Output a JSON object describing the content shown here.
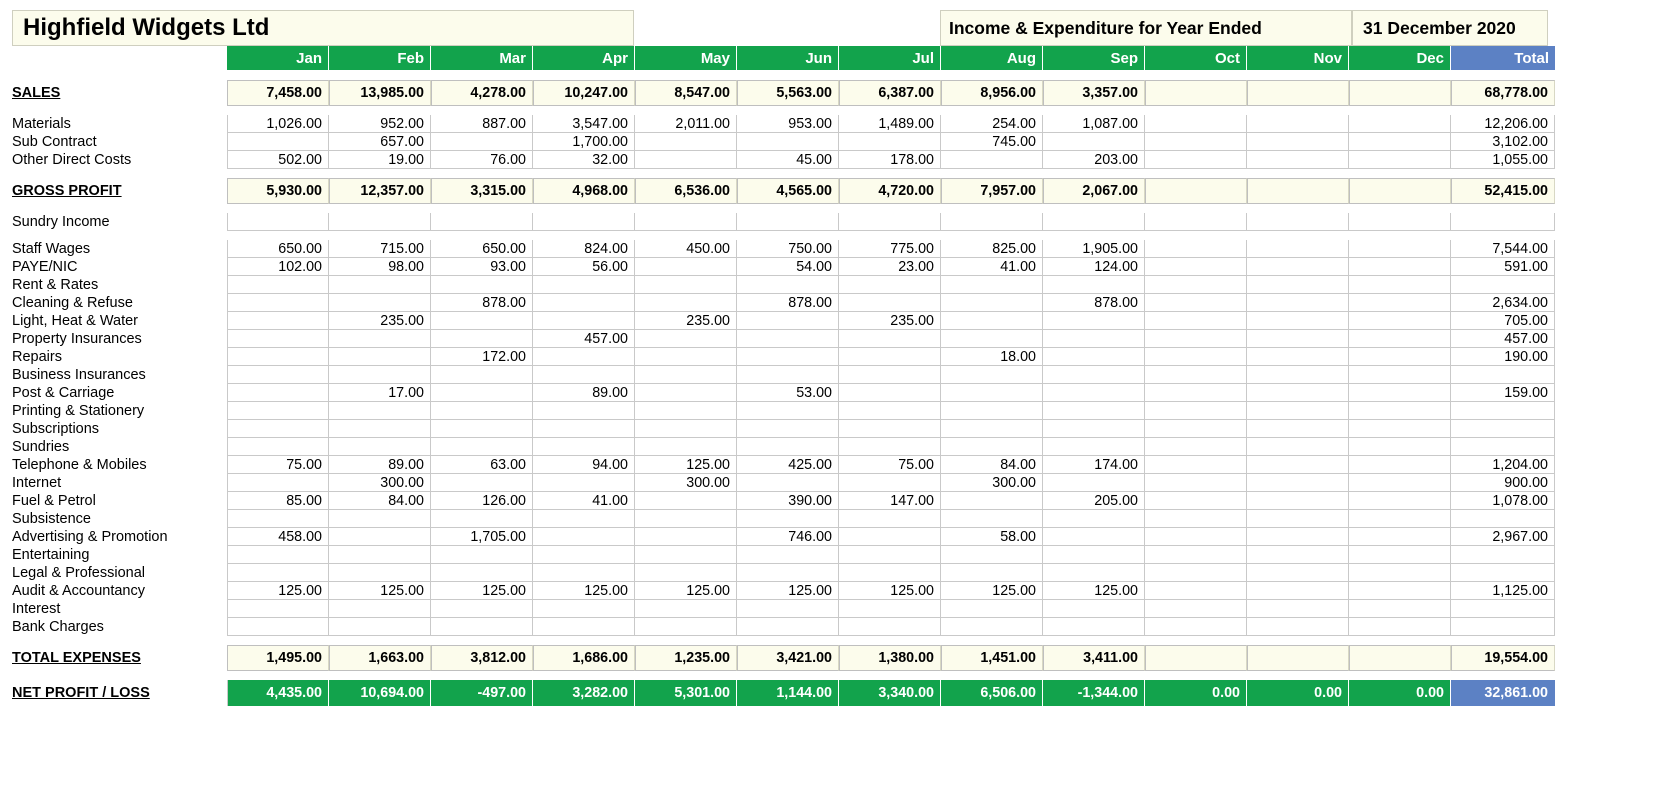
{
  "document": {
    "company": "Highfield Widgets Ltd",
    "report_title": "Income & Expenditure for Year Ended",
    "period_end": "31 December 2020"
  },
  "colors": {
    "header_green": "#12a34c",
    "total_blue": "#5c81c4",
    "summary_cream": "#fcfcec",
    "grid_line": "#c9c9c9"
  },
  "columns": [
    "Jan",
    "Feb",
    "Mar",
    "Apr",
    "May",
    "Jun",
    "Jul",
    "Aug",
    "Sep",
    "Oct",
    "Nov",
    "Dec"
  ],
  "total_column_label": "Total",
  "rows": {
    "sales": {
      "label": "SALES",
      "values": [
        "7,458.00",
        "13,985.00",
        "4,278.00",
        "10,247.00",
        "8,547.00",
        "5,563.00",
        "6,387.00",
        "8,956.00",
        "3,357.00",
        "",
        "",
        ""
      ],
      "total": "68,778.00"
    },
    "cost_of_sales": [
      {
        "label": "Materials",
        "values": [
          "1,026.00",
          "952.00",
          "887.00",
          "3,547.00",
          "2,011.00",
          "953.00",
          "1,489.00",
          "254.00",
          "1,087.00",
          "",
          "",
          ""
        ],
        "total": "12,206.00"
      },
      {
        "label": "Sub Contract",
        "values": [
          "",
          "657.00",
          "",
          "1,700.00",
          "",
          "",
          "",
          "745.00",
          "",
          "",
          "",
          ""
        ],
        "total": "3,102.00"
      },
      {
        "label": "Other Direct Costs",
        "values": [
          "502.00",
          "19.00",
          "76.00",
          "32.00",
          "",
          "45.00",
          "178.00",
          "",
          "203.00",
          "",
          "",
          ""
        ],
        "total": "1,055.00"
      }
    ],
    "gross_profit": {
      "label": "GROSS PROFIT",
      "values": [
        "5,930.00",
        "12,357.00",
        "3,315.00",
        "4,968.00",
        "6,536.00",
        "4,565.00",
        "4,720.00",
        "7,957.00",
        "2,067.00",
        "",
        "",
        ""
      ],
      "total": "52,415.00"
    },
    "sundry_income": {
      "label": "Sundry Income",
      "values": [
        "",
        "",
        "",
        "",
        "",
        "",
        "",
        "",
        "",
        "",
        "",
        ""
      ],
      "total": ""
    },
    "expenses": [
      {
        "label": "Staff Wages",
        "values": [
          "650.00",
          "715.00",
          "650.00",
          "824.00",
          "450.00",
          "750.00",
          "775.00",
          "825.00",
          "1,905.00",
          "",
          "",
          ""
        ],
        "total": "7,544.00"
      },
      {
        "label": "PAYE/NIC",
        "values": [
          "102.00",
          "98.00",
          "93.00",
          "56.00",
          "",
          "54.00",
          "23.00",
          "41.00",
          "124.00",
          "",
          "",
          ""
        ],
        "total": "591.00"
      },
      {
        "label": "Rent & Rates",
        "values": [
          "",
          "",
          "",
          "",
          "",
          "",
          "",
          "",
          "",
          "",
          "",
          ""
        ],
        "total": ""
      },
      {
        "label": "Cleaning & Refuse",
        "values": [
          "",
          "",
          "878.00",
          "",
          "",
          "878.00",
          "",
          "",
          "878.00",
          "",
          "",
          ""
        ],
        "total": "2,634.00"
      },
      {
        "label": "Light, Heat & Water",
        "values": [
          "",
          "235.00",
          "",
          "",
          "235.00",
          "",
          "235.00",
          "",
          "",
          "",
          "",
          ""
        ],
        "total": "705.00"
      },
      {
        "label": "Property Insurances",
        "values": [
          "",
          "",
          "",
          "457.00",
          "",
          "",
          "",
          "",
          "",
          "",
          "",
          ""
        ],
        "total": "457.00"
      },
      {
        "label": "Repairs",
        "values": [
          "",
          "",
          "172.00",
          "",
          "",
          "",
          "",
          "18.00",
          "",
          "",
          "",
          ""
        ],
        "total": "190.00"
      },
      {
        "label": "Business Insurances",
        "values": [
          "",
          "",
          "",
          "",
          "",
          "",
          "",
          "",
          "",
          "",
          "",
          ""
        ],
        "total": ""
      },
      {
        "label": "Post & Carriage",
        "values": [
          "",
          "17.00",
          "",
          "89.00",
          "",
          "53.00",
          "",
          "",
          "",
          "",
          "",
          ""
        ],
        "total": "159.00"
      },
      {
        "label": "Printing & Stationery",
        "values": [
          "",
          "",
          "",
          "",
          "",
          "",
          "",
          "",
          "",
          "",
          "",
          ""
        ],
        "total": ""
      },
      {
        "label": "Subscriptions",
        "values": [
          "",
          "",
          "",
          "",
          "",
          "",
          "",
          "",
          "",
          "",
          "",
          ""
        ],
        "total": ""
      },
      {
        "label": "Sundries",
        "values": [
          "",
          "",
          "",
          "",
          "",
          "",
          "",
          "",
          "",
          "",
          "",
          ""
        ],
        "total": ""
      },
      {
        "label": "Telephone & Mobiles",
        "values": [
          "75.00",
          "89.00",
          "63.00",
          "94.00",
          "125.00",
          "425.00",
          "75.00",
          "84.00",
          "174.00",
          "",
          "",
          ""
        ],
        "total": "1,204.00"
      },
      {
        "label": "Internet",
        "values": [
          "",
          "300.00",
          "",
          "",
          "300.00",
          "",
          "",
          "300.00",
          "",
          "",
          "",
          ""
        ],
        "total": "900.00"
      },
      {
        "label": "Fuel & Petrol",
        "values": [
          "85.00",
          "84.00",
          "126.00",
          "41.00",
          "",
          "390.00",
          "147.00",
          "",
          "205.00",
          "",
          "",
          ""
        ],
        "total": "1,078.00"
      },
      {
        "label": "Subsistence",
        "values": [
          "",
          "",
          "",
          "",
          "",
          "",
          "",
          "",
          "",
          "",
          "",
          ""
        ],
        "total": ""
      },
      {
        "label": "Advertising & Promotion",
        "values": [
          "458.00",
          "",
          "1,705.00",
          "",
          "",
          "746.00",
          "",
          "58.00",
          "",
          "",
          "",
          ""
        ],
        "total": "2,967.00"
      },
      {
        "label": "Entertaining",
        "values": [
          "",
          "",
          "",
          "",
          "",
          "",
          "",
          "",
          "",
          "",
          "",
          ""
        ],
        "total": ""
      },
      {
        "label": "Legal & Professional",
        "values": [
          "",
          "",
          "",
          "",
          "",
          "",
          "",
          "",
          "",
          "",
          "",
          ""
        ],
        "total": ""
      },
      {
        "label": "Audit & Accountancy",
        "values": [
          "125.00",
          "125.00",
          "125.00",
          "125.00",
          "125.00",
          "125.00",
          "125.00",
          "125.00",
          "125.00",
          "",
          "",
          ""
        ],
        "total": "1,125.00"
      },
      {
        "label": "Interest",
        "values": [
          "",
          "",
          "",
          "",
          "",
          "",
          "",
          "",
          "",
          "",
          "",
          ""
        ],
        "total": ""
      },
      {
        "label": "Bank Charges",
        "values": [
          "",
          "",
          "",
          "",
          "",
          "",
          "",
          "",
          "",
          "",
          "",
          ""
        ],
        "total": ""
      }
    ],
    "total_expenses": {
      "label": "TOTAL EXPENSES",
      "values": [
        "1,495.00",
        "1,663.00",
        "3,812.00",
        "1,686.00",
        "1,235.00",
        "3,421.00",
        "1,380.00",
        "1,451.00",
        "3,411.00",
        "",
        "",
        ""
      ],
      "total": "19,554.00"
    },
    "net_profit_loss": {
      "label": "NET PROFIT / LOSS",
      "values": [
        "4,435.00",
        "10,694.00",
        "-497.00",
        "3,282.00",
        "5,301.00",
        "1,144.00",
        "3,340.00",
        "6,506.00",
        "-1,344.00",
        "0.00",
        "0.00",
        "0.00"
      ],
      "total": "32,861.00"
    }
  }
}
